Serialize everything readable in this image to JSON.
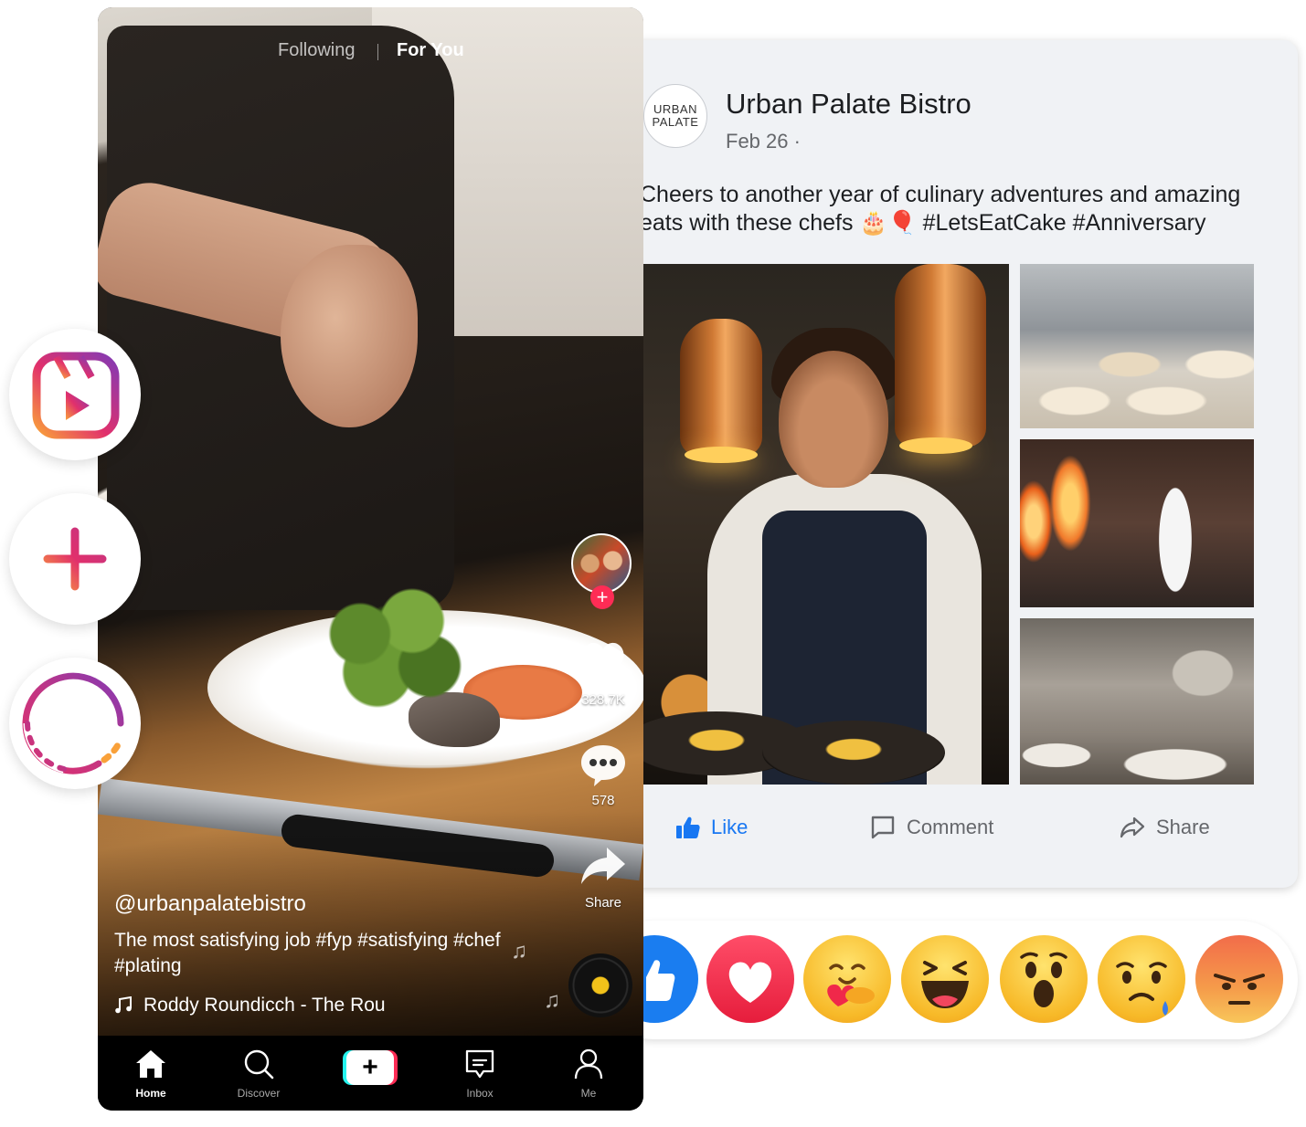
{
  "tiktok": {
    "tabs": {
      "following": "Following",
      "for_you": "For You"
    },
    "likes": "328.7K",
    "comments": "578",
    "share_label": "Share",
    "username": "@urbanpalatebistro",
    "caption": "The most satisfying job #fyp #satisfying #chef #plating",
    "sound": "Roddy Roundicch - The Rou",
    "nav": {
      "home": "Home",
      "discover": "Discover",
      "create": "+",
      "inbox": "Inbox",
      "me": "Me"
    },
    "colors": {
      "like_heart": "#ffffff",
      "follow_badge": "#fe2c55",
      "create_left": "#25f4ee",
      "create_right": "#fe2c55"
    }
  },
  "facebook": {
    "avatar": {
      "line1": "URBAN",
      "line2": "PALATE"
    },
    "page_name": "Urban Palate Bistro",
    "date": "Feb 26 ·",
    "post_text": "Cheers to another year of culinary adventures and amazing eats with these chefs 🎂🎈 #LetsEatCake #Anniversary",
    "actions": {
      "like": "Like",
      "comment": "Comment",
      "share": "Share"
    },
    "colors": {
      "like_active": "#1877f2",
      "action_gray": "#65676b"
    }
  },
  "reactions": [
    "like-icon",
    "love-icon",
    "care-icon",
    "haha-icon",
    "wow-icon",
    "sad-icon",
    "angry-icon"
  ],
  "floating_icons": [
    "reels-icon",
    "create-plus-icon",
    "story-ring-icon"
  ]
}
